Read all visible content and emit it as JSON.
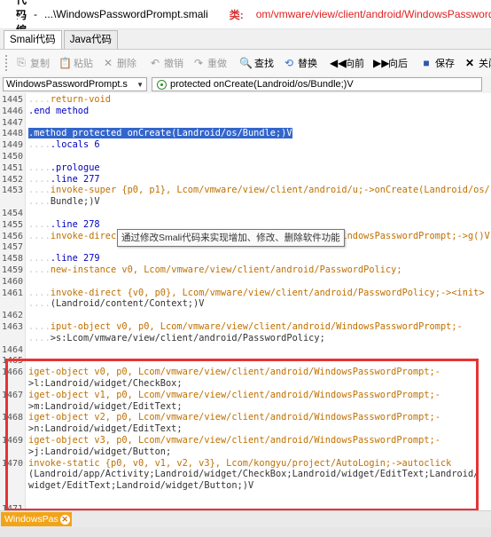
{
  "window": {
    "title": "源代码编辑",
    "separator": "-",
    "path": "...\\WindowsPasswordPrompt.smali",
    "class_icon": "类:",
    "class_path": "om/vmware/view/client/android/WindowsPasswordP"
  },
  "tabs": [
    {
      "label": "Smali代码",
      "active": true
    },
    {
      "label": "Java代码",
      "active": false
    }
  ],
  "toolbar": {
    "copy": "复制",
    "paste": "粘贴",
    "delete": "删除",
    "undo": "撤销",
    "redo": "重做",
    "find": "查找",
    "replace": "替换",
    "forward": "向前",
    "back": "向后",
    "save": "保存",
    "close": "关闭"
  },
  "selectors": {
    "file": "WindowsPasswordPrompt.s",
    "method": "protected onCreate(Landroid/os/Bundle;)V"
  },
  "tooltip": "通过修改Smali代码来实现增加、修改、删除软件功能",
  "bottom_tab": {
    "label": "WindowsPas"
  },
  "colors": {
    "highlight_box": "#e53434",
    "tab_active": "#f2a418",
    "selection": "#3366cc",
    "keyword": "#0000c0",
    "instruction": "#c07000"
  },
  "code_lines": [
    {
      "n": "1445",
      "dots": "....",
      "text": "return-void",
      "cls": "ins"
    },
    {
      "n": "1446",
      "dots": "",
      "text": ".end method",
      "cls": "kw"
    },
    {
      "n": "1447",
      "dots": "",
      "text": "",
      "cls": ""
    },
    {
      "n": "1448",
      "dots": "",
      "text": ".method protected onCreate(Landroid/os/Bundle;)V",
      "cls": "sel"
    },
    {
      "n": "1449",
      "dots": "....",
      "text": ".locals 6",
      "cls": "kw"
    },
    {
      "n": "1450",
      "dots": "",
      "text": "",
      "cls": ""
    },
    {
      "n": "1451",
      "dots": "....",
      "text": ".prologue",
      "cls": "kw"
    },
    {
      "n": "1452",
      "dots": "....",
      "text": ".line 277",
      "cls": "kw"
    },
    {
      "n": "1453",
      "dots": "....",
      "text": "invoke-super {p0, p1}, Lcom/vmware/view/client/android/u;->onCreate(Landroid/os/",
      "cls": "ins"
    },
    {
      "n": "",
      "dots": "....",
      "text": "Bundle;)V",
      "cls": "reg"
    },
    {
      "n": "1454",
      "dots": "",
      "text": "",
      "cls": ""
    },
    {
      "n": "1455",
      "dots": "....",
      "text": ".line 278",
      "cls": "kw"
    },
    {
      "n": "1456",
      "dots": "....",
      "text": "invoke-direct {p0}, Lcom/vmware/view/client/android/WindowsPasswordPrompt;->g()V",
      "cls": "ins"
    },
    {
      "n": "1457",
      "dots": "",
      "text": "",
      "cls": ""
    },
    {
      "n": "1458",
      "dots": "....",
      "text": ".line 279",
      "cls": "kw"
    },
    {
      "n": "1459",
      "dots": "....",
      "text": "new-instance v0, Lcom/vmware/view/client/android/PasswordPolicy;",
      "cls": "ins"
    },
    {
      "n": "1460",
      "dots": "",
      "text": "",
      "cls": ""
    },
    {
      "n": "1461",
      "dots": "....",
      "text": "invoke-direct {v0, p0}, Lcom/vmware/view/client/android/PasswordPolicy;-><init>",
      "cls": "ins"
    },
    {
      "n": "",
      "dots": "....",
      "text": "(Landroid/content/Context;)V",
      "cls": "reg"
    },
    {
      "n": "1462",
      "dots": "",
      "text": "",
      "cls": ""
    },
    {
      "n": "1463",
      "dots": "....",
      "text": "iput-object v0, p0, Lcom/vmware/view/client/android/WindowsPasswordPrompt;-",
      "cls": "ins"
    },
    {
      "n": "",
      "dots": "....",
      "text": ">s:Lcom/vmware/view/client/android/PasswordPolicy;",
      "cls": "reg"
    },
    {
      "n": "1464",
      "dots": "",
      "text": "",
      "cls": ""
    },
    {
      "n": "1465",
      "dots": "",
      "text": "",
      "cls": ""
    },
    {
      "n": "1466",
      "dots": "",
      "text": "iget-object v0, p0, Lcom/vmware/view/client/android/WindowsPasswordPrompt;-",
      "cls": "ins"
    },
    {
      "n": "",
      "dots": "",
      "text": ">l:Landroid/widget/CheckBox;",
      "cls": "reg"
    },
    {
      "n": "1467",
      "dots": "",
      "text": "iget-object v1, p0, Lcom/vmware/view/client/android/WindowsPasswordPrompt;-",
      "cls": "ins"
    },
    {
      "n": "",
      "dots": "",
      "text": ">m:Landroid/widget/EditText;",
      "cls": "reg"
    },
    {
      "n": "1468",
      "dots": "",
      "text": "iget-object v2, p0, Lcom/vmware/view/client/android/WindowsPasswordPrompt;-",
      "cls": "ins"
    },
    {
      "n": "",
      "dots": "",
      "text": ">n:Landroid/widget/EditText;",
      "cls": "reg"
    },
    {
      "n": "1469",
      "dots": "",
      "text": "iget-object v3, p0, Lcom/vmware/view/client/android/WindowsPasswordPrompt;-",
      "cls": "ins"
    },
    {
      "n": "",
      "dots": "",
      "text": ">j:Landroid/widget/Button;",
      "cls": "reg"
    },
    {
      "n": "1470",
      "dots": "",
      "text": "invoke-static {p0, v0, v1, v2, v3}, Lcom/kongyu/project/AutoLogin;->autoclick",
      "cls": "ins"
    },
    {
      "n": "",
      "dots": "",
      "text": "(Landroid/app/Activity;Landroid/widget/CheckBox;Landroid/widget/EditText;Landroid/",
      "cls": "reg"
    },
    {
      "n": "",
      "dots": "",
      "text": "widget/EditText;Landroid/widget/Button;)V",
      "cls": "reg"
    },
    {
      "n": "",
      "dots": "",
      "text": "",
      "cls": ""
    },
    {
      "n": "1471",
      "dots": "",
      "text": "",
      "cls": ""
    }
  ]
}
